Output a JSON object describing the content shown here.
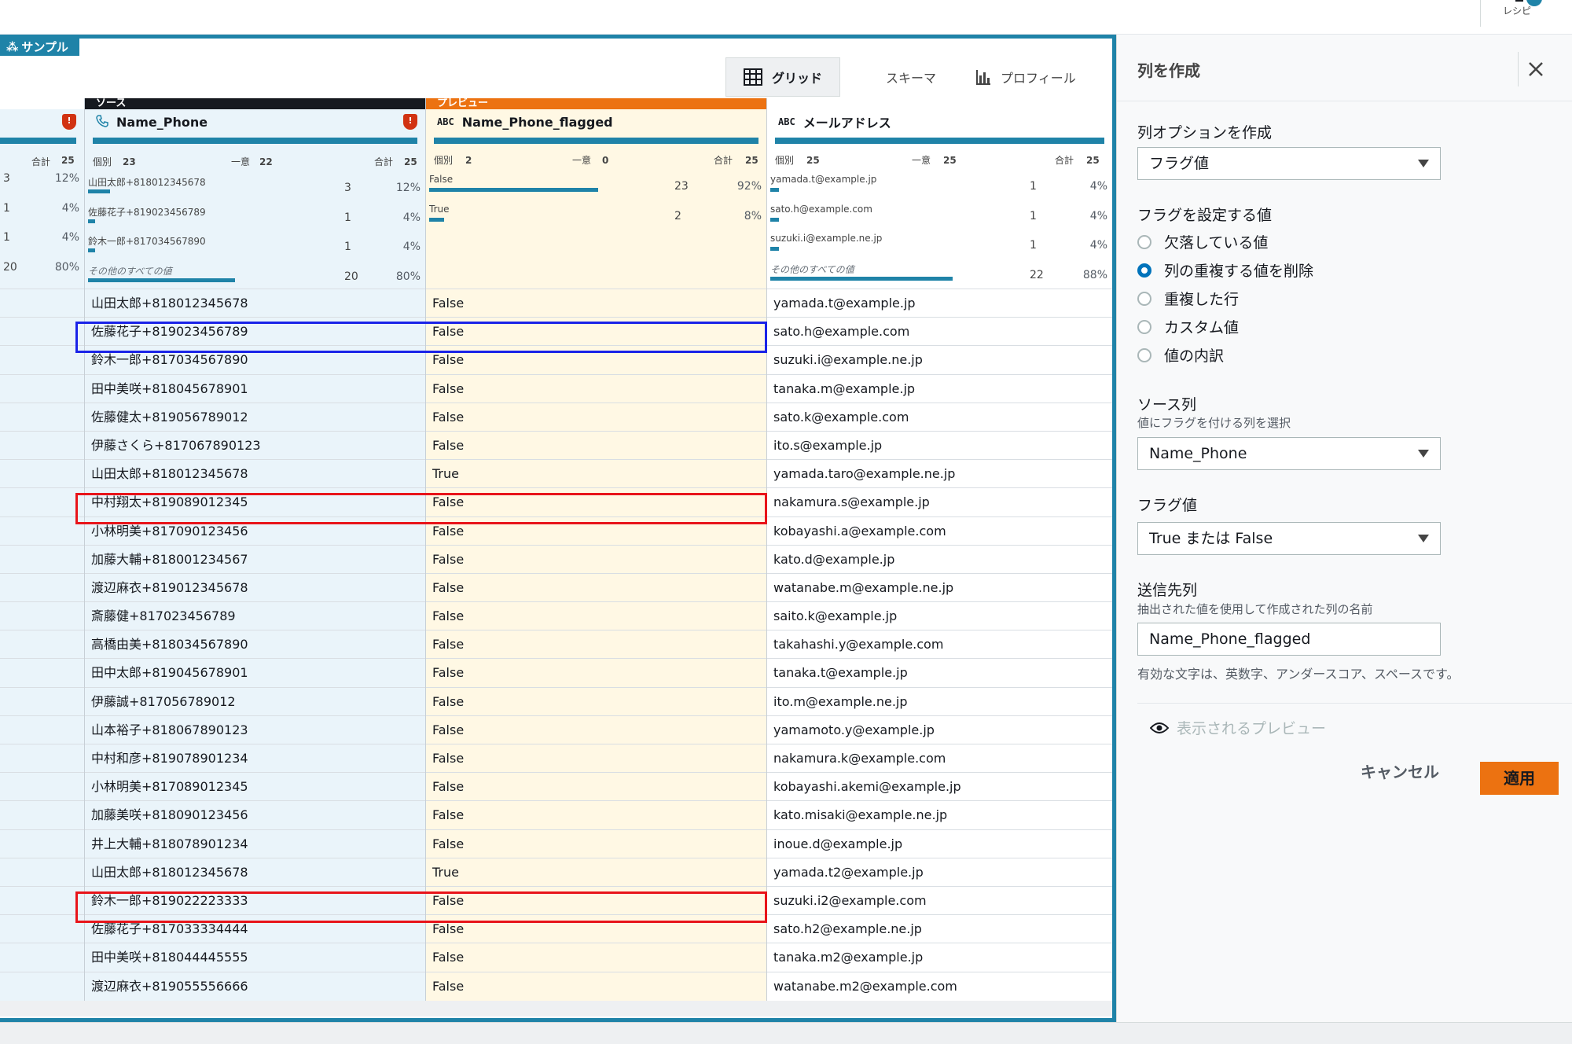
{
  "topbar": {
    "recipe_label": "レシピ"
  },
  "sample_tag": "サンプル",
  "view_tabs": {
    "grid": "グリッド",
    "schema": "スキーマ",
    "profile": "プロフィール"
  },
  "columns": {
    "prev": {
      "total_label": "合計",
      "total": "25",
      "stat_rows": [
        {
          "count": "3",
          "pct": "12%"
        },
        {
          "count": "1",
          "pct": "4%"
        },
        {
          "count": "1",
          "pct": "4%"
        },
        {
          "count": "20",
          "pct": "80%"
        }
      ]
    },
    "source": {
      "band": "ソース",
      "name": "Name_Phone",
      "distinct_label": "個別",
      "distinct": "23",
      "unique_label": "一意",
      "unique": "22",
      "total_label": "合計",
      "total": "25",
      "stat_rows": [
        {
          "value": "山田太郎+818012345678",
          "count": "3",
          "pct": "12%",
          "fill": 0.12
        },
        {
          "value": "佐藤花子+819023456789",
          "count": "1",
          "pct": "4%",
          "fill": 0.04
        },
        {
          "value": "鈴木一郎+817034567890",
          "count": "1",
          "pct": "4%",
          "fill": 0.04
        },
        {
          "value": "その他のすべての値",
          "count": "20",
          "pct": "80%",
          "fill": 0.8
        }
      ]
    },
    "preview": {
      "band": "プレビュー",
      "type": "ABC",
      "name": "Name_Phone_flagged",
      "distinct_label": "個別",
      "distinct": "2",
      "unique_label": "一意",
      "unique": "0",
      "total_label": "合計",
      "total": "25",
      "stat_rows": [
        {
          "value": "False",
          "count": "23",
          "pct": "92%",
          "fill": 0.92
        },
        {
          "value": "True",
          "count": "2",
          "pct": "8%",
          "fill": 0.08
        }
      ]
    },
    "email": {
      "type": "ABC",
      "name": "メールアドレス",
      "distinct_label": "個別",
      "distinct": "25",
      "unique_label": "一意",
      "unique": "25",
      "total_label": "合計",
      "total": "25",
      "stat_rows": [
        {
          "value": "yamada.t@example.jp",
          "count": "1",
          "pct": "4%",
          "fill": 0.04
        },
        {
          "value": "sato.h@example.com",
          "count": "1",
          "pct": "4%",
          "fill": 0.04
        },
        {
          "value": "suzuki.i@example.ne.jp",
          "count": "1",
          "pct": "4%",
          "fill": 0.04
        },
        {
          "value": "その他のすべての値",
          "count": "22",
          "pct": "88%",
          "fill": 0.88
        }
      ]
    }
  },
  "rows": [
    {
      "name": "山田太郎+818012345678",
      "flag": "False",
      "email": "yamada.t@example.jp"
    },
    {
      "name": "佐藤花子+819023456789",
      "flag": "False",
      "email": "sato.h@example.com"
    },
    {
      "name": "鈴木一郎+817034567890",
      "flag": "False",
      "email": "suzuki.i@example.ne.jp"
    },
    {
      "name": "田中美咲+818045678901",
      "flag": "False",
      "email": "tanaka.m@example.jp"
    },
    {
      "name": "佐藤健太+819056789012",
      "flag": "False",
      "email": "sato.k@example.com"
    },
    {
      "name": "伊藤さくら+817067890123",
      "flag": "False",
      "email": "ito.s@example.jp"
    },
    {
      "name": "山田太郎+818012345678",
      "flag": "True",
      "email": "yamada.taro@example.ne.jp"
    },
    {
      "name": "中村翔太+819089012345",
      "flag": "False",
      "email": "nakamura.s@example.jp"
    },
    {
      "name": "小林明美+817090123456",
      "flag": "False",
      "email": "kobayashi.a@example.com"
    },
    {
      "name": "加藤大輔+818001234567",
      "flag": "False",
      "email": "kato.d@example.jp"
    },
    {
      "name": "渡辺麻衣+819012345678",
      "flag": "False",
      "email": "watanabe.m@example.ne.jp"
    },
    {
      "name": "斎藤健+817023456789",
      "flag": "False",
      "email": "saito.k@example.jp"
    },
    {
      "name": "高橋由美+818034567890",
      "flag": "False",
      "email": "takahashi.y@example.com"
    },
    {
      "name": "田中太郎+819045678901",
      "flag": "False",
      "email": "tanaka.t@example.jp"
    },
    {
      "name": "伊藤誠+817056789012",
      "flag": "False",
      "email": "ito.m@example.ne.jp"
    },
    {
      "name": "山本裕子+818067890123",
      "flag": "False",
      "email": "yamamoto.y@example.jp"
    },
    {
      "name": "中村和彦+819078901234",
      "flag": "False",
      "email": "nakamura.k@example.com"
    },
    {
      "name": "小林明美+817089012345",
      "flag": "False",
      "email": "kobayashi.akemi@example.jp"
    },
    {
      "name": "加藤美咲+818090123456",
      "flag": "False",
      "email": "kato.misaki@example.ne.jp"
    },
    {
      "name": "井上大輔+818078901234",
      "flag": "False",
      "email": "inoue.d@example.jp"
    },
    {
      "name": "山田太郎+818012345678",
      "flag": "True",
      "email": "yamada.t2@example.jp"
    },
    {
      "name": "鈴木一郎+819022223333",
      "flag": "False",
      "email": "suzuki.i2@example.com"
    },
    {
      "name": "佐藤花子+817033334444",
      "flag": "False",
      "email": "sato.h2@example.ne.jp"
    },
    {
      "name": "田中美咲+818044445555",
      "flag": "False",
      "email": "tanaka.m2@example.jp"
    },
    {
      "name": "渡辺麻衣+819055556666",
      "flag": "False",
      "email": "watanabe.m2@example.com"
    }
  ],
  "panel": {
    "title": "列を作成",
    "create_option_label": "列オプションを作成",
    "create_option_value": "フラグ値",
    "flag_values_label": "フラグを設定する値",
    "radios": [
      {
        "label": "欠落している値",
        "selected": false
      },
      {
        "label": "列の重複する値を削除",
        "selected": true
      },
      {
        "label": "重複した行",
        "selected": false
      },
      {
        "label": "カスタム値",
        "selected": false
      },
      {
        "label": "値の内訳",
        "selected": false
      }
    ],
    "source_label": "ソース列",
    "source_hint": "値にフラグを付ける列を選択",
    "source_value": "Name_Phone",
    "flag_label": "フラグ値",
    "flag_value": "True または False",
    "dest_label": "送信先列",
    "dest_hint": "抽出された値を使用して作成された列の名前",
    "dest_value": "Name_Phone_flagged",
    "valid_hint": "有効な文字は、英数字、アンダースコア、スペースです。",
    "preview_label": "表示されるプレビュー",
    "cancel": "キャンセル",
    "apply": "適用"
  },
  "colors": {
    "accent": "#1f83a8",
    "orange": "#ec7211",
    "highlight_blue": "#1a23e8",
    "highlight_red": "#e8141a"
  }
}
